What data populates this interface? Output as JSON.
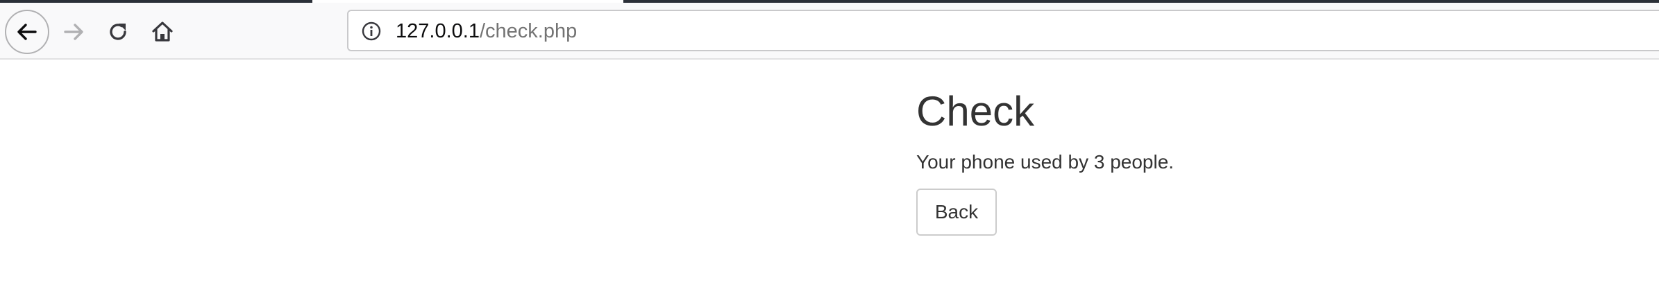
{
  "browser": {
    "url_host": "127.0.0.1",
    "url_path": "/check.php",
    "icons": {
      "back": "arrow-left-icon",
      "forward": "arrow-right-icon",
      "reload": "reload-icon",
      "home": "home-icon",
      "site_info": "info-circle-icon"
    },
    "colors": {
      "toolbar_bg": "#f9f9fa",
      "tab_indicator": "#2b3038",
      "url_path_text": "#737373"
    }
  },
  "page": {
    "title": "Check",
    "message": "Your phone used by 3 people.",
    "back_button_label": "Back"
  }
}
